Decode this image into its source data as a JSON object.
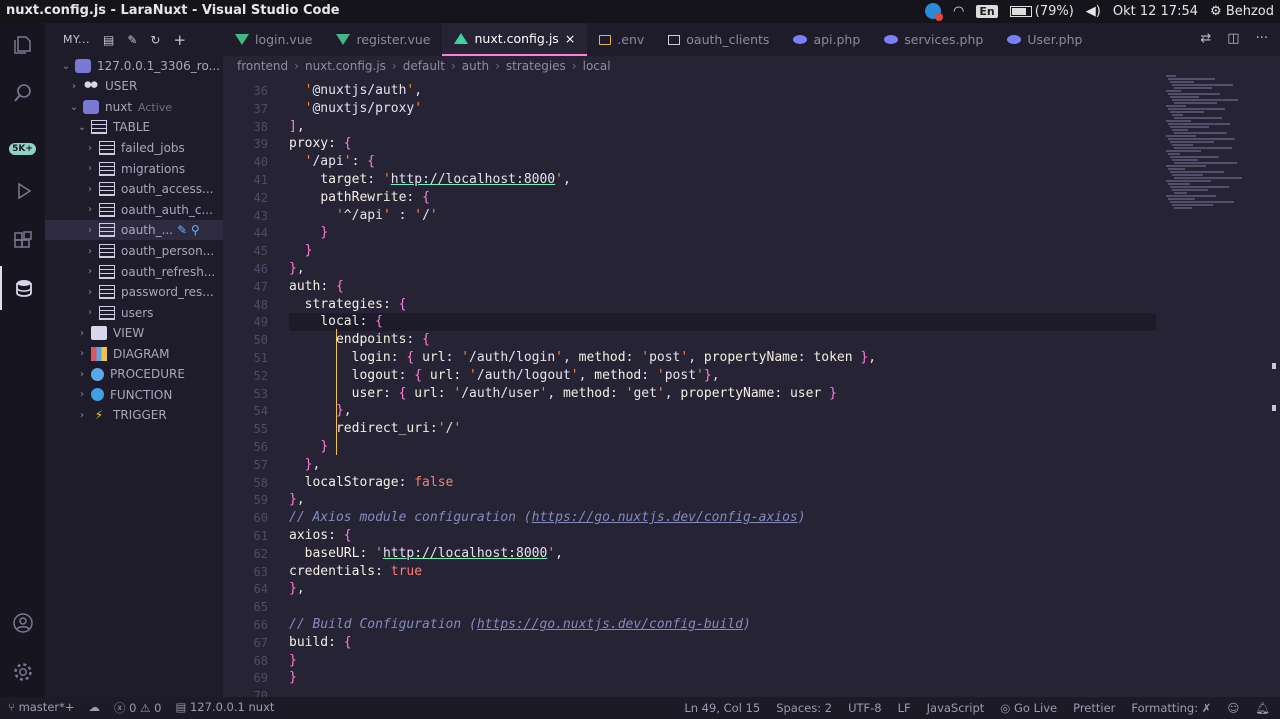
{
  "os_bar": {
    "title": "nuxt.config.js - LaraNuxt - Visual Studio Code",
    "lang": "En",
    "battery": "(79%)",
    "battery_level": 0.79,
    "datetime": "Okt 12 17:54",
    "user": "Behzod"
  },
  "activity_bar": {
    "items": [
      "explorer-icon",
      "search-icon",
      "source-control-icon",
      "run-debug-icon",
      "extensions-icon",
      "database-icon"
    ],
    "badge": "5K+",
    "bottom": [
      "account-icon",
      "settings-icon"
    ]
  },
  "sidebar": {
    "header": "MY...",
    "connection": "127.0.0.1_3306_ro...",
    "user_node": "USER",
    "db_node": "nuxt",
    "db_state": "Active",
    "table_node": "TABLE",
    "tables": [
      "failed_jobs",
      "migrations",
      "oauth_access...",
      "oauth_auth_c...",
      "oauth_...",
      "oauth_person...",
      "oauth_refresh...",
      "password_res...",
      "users"
    ],
    "sections": [
      "VIEW",
      "DIAGRAM",
      "PROCEDURE",
      "FUNCTION",
      "TRIGGER"
    ]
  },
  "tabs": [
    {
      "label": "login.vue",
      "icon": "vue"
    },
    {
      "label": "register.vue",
      "icon": "vue"
    },
    {
      "label": "nuxt.config.js",
      "icon": "nuxt",
      "active": true
    },
    {
      "label": ".env",
      "icon": "env"
    },
    {
      "label": "oauth_clients",
      "icon": "tbl"
    },
    {
      "label": "api.php",
      "icon": "php"
    },
    {
      "label": "services.php",
      "icon": "php"
    },
    {
      "label": "User.php",
      "icon": "php"
    }
  ],
  "breadcrumb": [
    "frontend",
    "nuxt.config.js",
    "default",
    "auth",
    "strategies",
    "local"
  ],
  "editor": {
    "lines": [
      {
        "n": 36,
        "t": "  '@nuxtjs/auth',"
      },
      {
        "n": 37,
        "t": "  '@nuxtjs/proxy'"
      },
      {
        "n": 38,
        "t": "],"
      },
      {
        "n": 39,
        "t": "proxy: {"
      },
      {
        "n": 40,
        "t": "  '/api': {"
      },
      {
        "n": 41,
        "t": "    target: 'http://localhost:8000',"
      },
      {
        "n": 42,
        "t": "    pathRewrite: {"
      },
      {
        "n": 43,
        "t": "      '^/api' : '/'"
      },
      {
        "n": 44,
        "t": "    }"
      },
      {
        "n": 45,
        "t": "  }"
      },
      {
        "n": 46,
        "t": "},"
      },
      {
        "n": 47,
        "t": "auth: {"
      },
      {
        "n": 48,
        "t": "  strategies: {"
      },
      {
        "n": 49,
        "t": "    local: {"
      },
      {
        "n": 50,
        "t": "      endpoints: {"
      },
      {
        "n": 51,
        "t": "        login: { url: '/auth/login', method: 'post', propertyName: token },"
      },
      {
        "n": 52,
        "t": "        logout: { url: '/auth/logout', method: 'post'},"
      },
      {
        "n": 53,
        "t": "        user: { url: '/auth/user', method: 'get', propertyName: user }"
      },
      {
        "n": 54,
        "t": "      },"
      },
      {
        "n": 55,
        "t": "      redirect_uri:'/'"
      },
      {
        "n": 56,
        "t": "    }"
      },
      {
        "n": 57,
        "t": "  },"
      },
      {
        "n": 58,
        "t": "  localStorage: false"
      },
      {
        "n": 59,
        "t": "},"
      },
      {
        "n": 60,
        "t": "// Axios module configuration (https://go.nuxtjs.dev/config-axios)"
      },
      {
        "n": 61,
        "t": "axios: {"
      },
      {
        "n": 62,
        "t": "  baseURL: 'http://localhost:8000',"
      },
      {
        "n": 63,
        "t": "credentials: true"
      },
      {
        "n": 64,
        "t": "},"
      },
      {
        "n": 65,
        "t": ""
      },
      {
        "n": 66,
        "t": "// Build Configuration (https://go.nuxtjs.dev/config-build)"
      },
      {
        "n": 67,
        "t": "build: {"
      },
      {
        "n": 68,
        "t": "}"
      },
      {
        "n": 69,
        "t": "}"
      },
      {
        "n": 70,
        "t": ""
      }
    ]
  },
  "status_bar": {
    "branch": "master*+",
    "errors": "0",
    "warnings": "0",
    "db": "127.0.0.1",
    "db_name": "nuxt",
    "cursor": "Ln 49, Col 15",
    "spaces": "Spaces: 2",
    "encoding": "UTF-8",
    "eol": "LF",
    "language": "JavaScript",
    "golive": "Go Live",
    "prettier": "Prettier",
    "formatting": "Formatting: ✗"
  }
}
